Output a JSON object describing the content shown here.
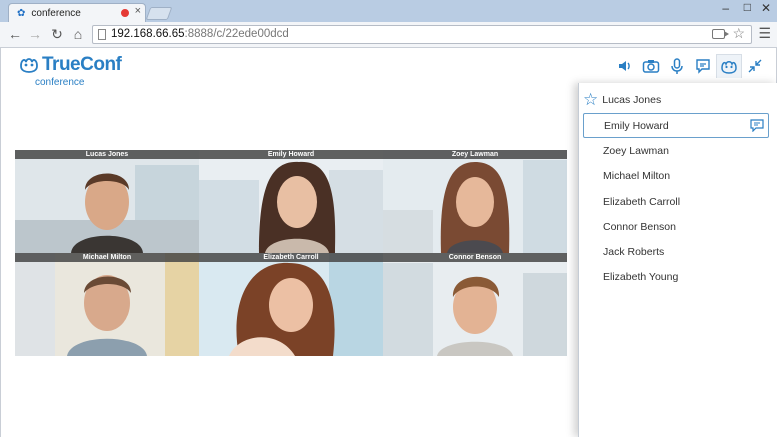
{
  "browser": {
    "tab_title": "conference",
    "url_host": "192.168.66.65",
    "url_rest": ":8888/c/22ede00dcd"
  },
  "app": {
    "brand": "TrueConf",
    "subtitle": "conference",
    "accent_color": "#2a7fc4",
    "toolbar_icons": [
      "speaker-icon",
      "camera-icon",
      "microphone-icon",
      "chat-icon",
      "participants-icon",
      "collapse-icon"
    ]
  },
  "video_tiles": [
    {
      "name": "Lucas Jones"
    },
    {
      "name": "Emily Howard"
    },
    {
      "name": "Zoey Lawman"
    },
    {
      "name": "Michael Milton"
    },
    {
      "name": "Elizabeth Carroll"
    },
    {
      "name": "Connor Benson"
    }
  ],
  "participants": {
    "owner": "Lucas Jones",
    "list": [
      {
        "name": "Emily Howard",
        "selected": true
      },
      {
        "name": "Zoey Lawman"
      },
      {
        "name": "Michael Milton"
      },
      {
        "name": "Elizabeth Carroll"
      },
      {
        "name": "Connor Benson"
      },
      {
        "name": "Jack Roberts"
      },
      {
        "name": "Elizabeth Young"
      }
    ]
  }
}
